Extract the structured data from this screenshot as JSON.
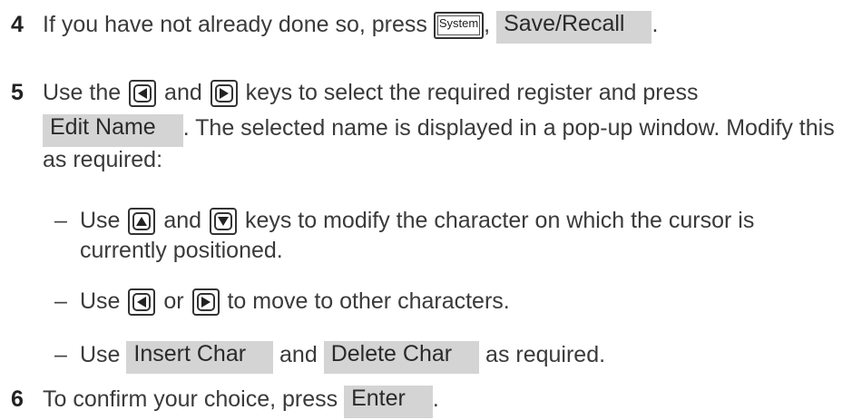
{
  "steps": {
    "s4": {
      "number": "4",
      "text_before": "If you have not already done so, press ",
      "system_key": "System",
      "comma": ",",
      "softkey": "Save/Recall",
      "end": "."
    },
    "s5": {
      "number": "5",
      "text_a": "Use the ",
      "text_and": " and ",
      "text_b": " keys to select the required register and press",
      "softkey": "Edit Name",
      "text_c": ". The selected name is displayed in a pop-up window. Modify this",
      "text_d": "as required:"
    },
    "b1": {
      "dash": "–",
      "text_a": "Use ",
      "text_and": " and ",
      "text_b": " keys to modify the character on which the cursor is",
      "text_c": "currently positioned."
    },
    "b2": {
      "dash": "–",
      "text_a": "Use ",
      "text_or": " or ",
      "text_b": " to move to other characters."
    },
    "b3": {
      "dash": "–",
      "text_a": "Use ",
      "softkey1": "Insert Char",
      "text_and": " and ",
      "softkey2": "Delete Char",
      "text_b": " as required."
    },
    "s6": {
      "number": "6",
      "text_a": "To confirm your choice, press ",
      "softkey": "Enter",
      "end": "."
    }
  },
  "icons": [
    "left-arrow-key-icon",
    "right-arrow-key-icon",
    "up-arrow-key-icon",
    "down-arrow-key-icon",
    "system-key-icon"
  ],
  "colors": {
    "softkey_bg": "#d4d4d4",
    "text": "#3a3a3a"
  }
}
